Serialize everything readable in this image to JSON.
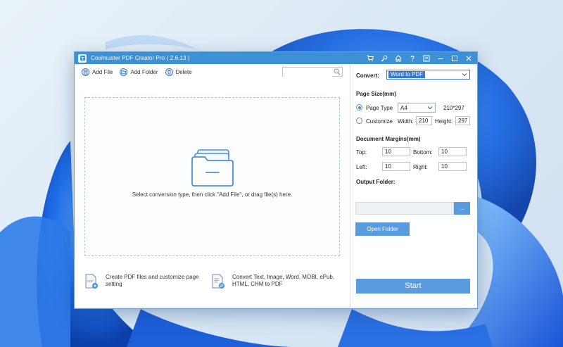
{
  "window": {
    "title": "Coolmuster PDF Creator Pro  ( 2.6.13 )",
    "title_icons": [
      "cart-icon",
      "key-icon",
      "home-icon",
      "help-icon",
      "feedback-icon",
      "minimize-icon",
      "maximize-icon",
      "close-icon"
    ]
  },
  "toolbar": {
    "add_file": "Add File",
    "add_folder": "Add Folder",
    "delete": "Delete",
    "search_value": ""
  },
  "drop_zone": {
    "text": "Select conversion type, then click \"Add File\", or drag file(s) here."
  },
  "features": [
    {
      "text": "Create PDF files and customize page setting"
    },
    {
      "text": "Convert Text, Image, Word, MOBI, ePub, HTML, CHM to PDF"
    }
  ],
  "settings": {
    "convert_label": "Convert:",
    "convert_value": "Word to PDF",
    "page_size_title": "Page Size(mm)",
    "page_type_label": "Page Type",
    "page_type_value": "A4",
    "page_type_dims": "210*297",
    "customize_label": "Customize",
    "width_label": "Width:",
    "width_value": "210",
    "height_label": "Height:",
    "height_value": "297",
    "margins_title": "Document Margins(mm)",
    "top_label": "Top:",
    "top_value": "10",
    "bottom_label": "Bottom:",
    "bottom_value": "10",
    "left_label": "Left:",
    "left_value": "10",
    "right_label": "Right:",
    "right_value": "10",
    "output_title": "Output Folder:",
    "output_value": "",
    "browse_label": "...",
    "open_folder_label": "Open Folder",
    "start_label": "Start"
  },
  "colors": {
    "titlebar": "#3d8fd6",
    "accent_button": "#5a9be0",
    "selected_dropdown": "#3b78c9"
  }
}
